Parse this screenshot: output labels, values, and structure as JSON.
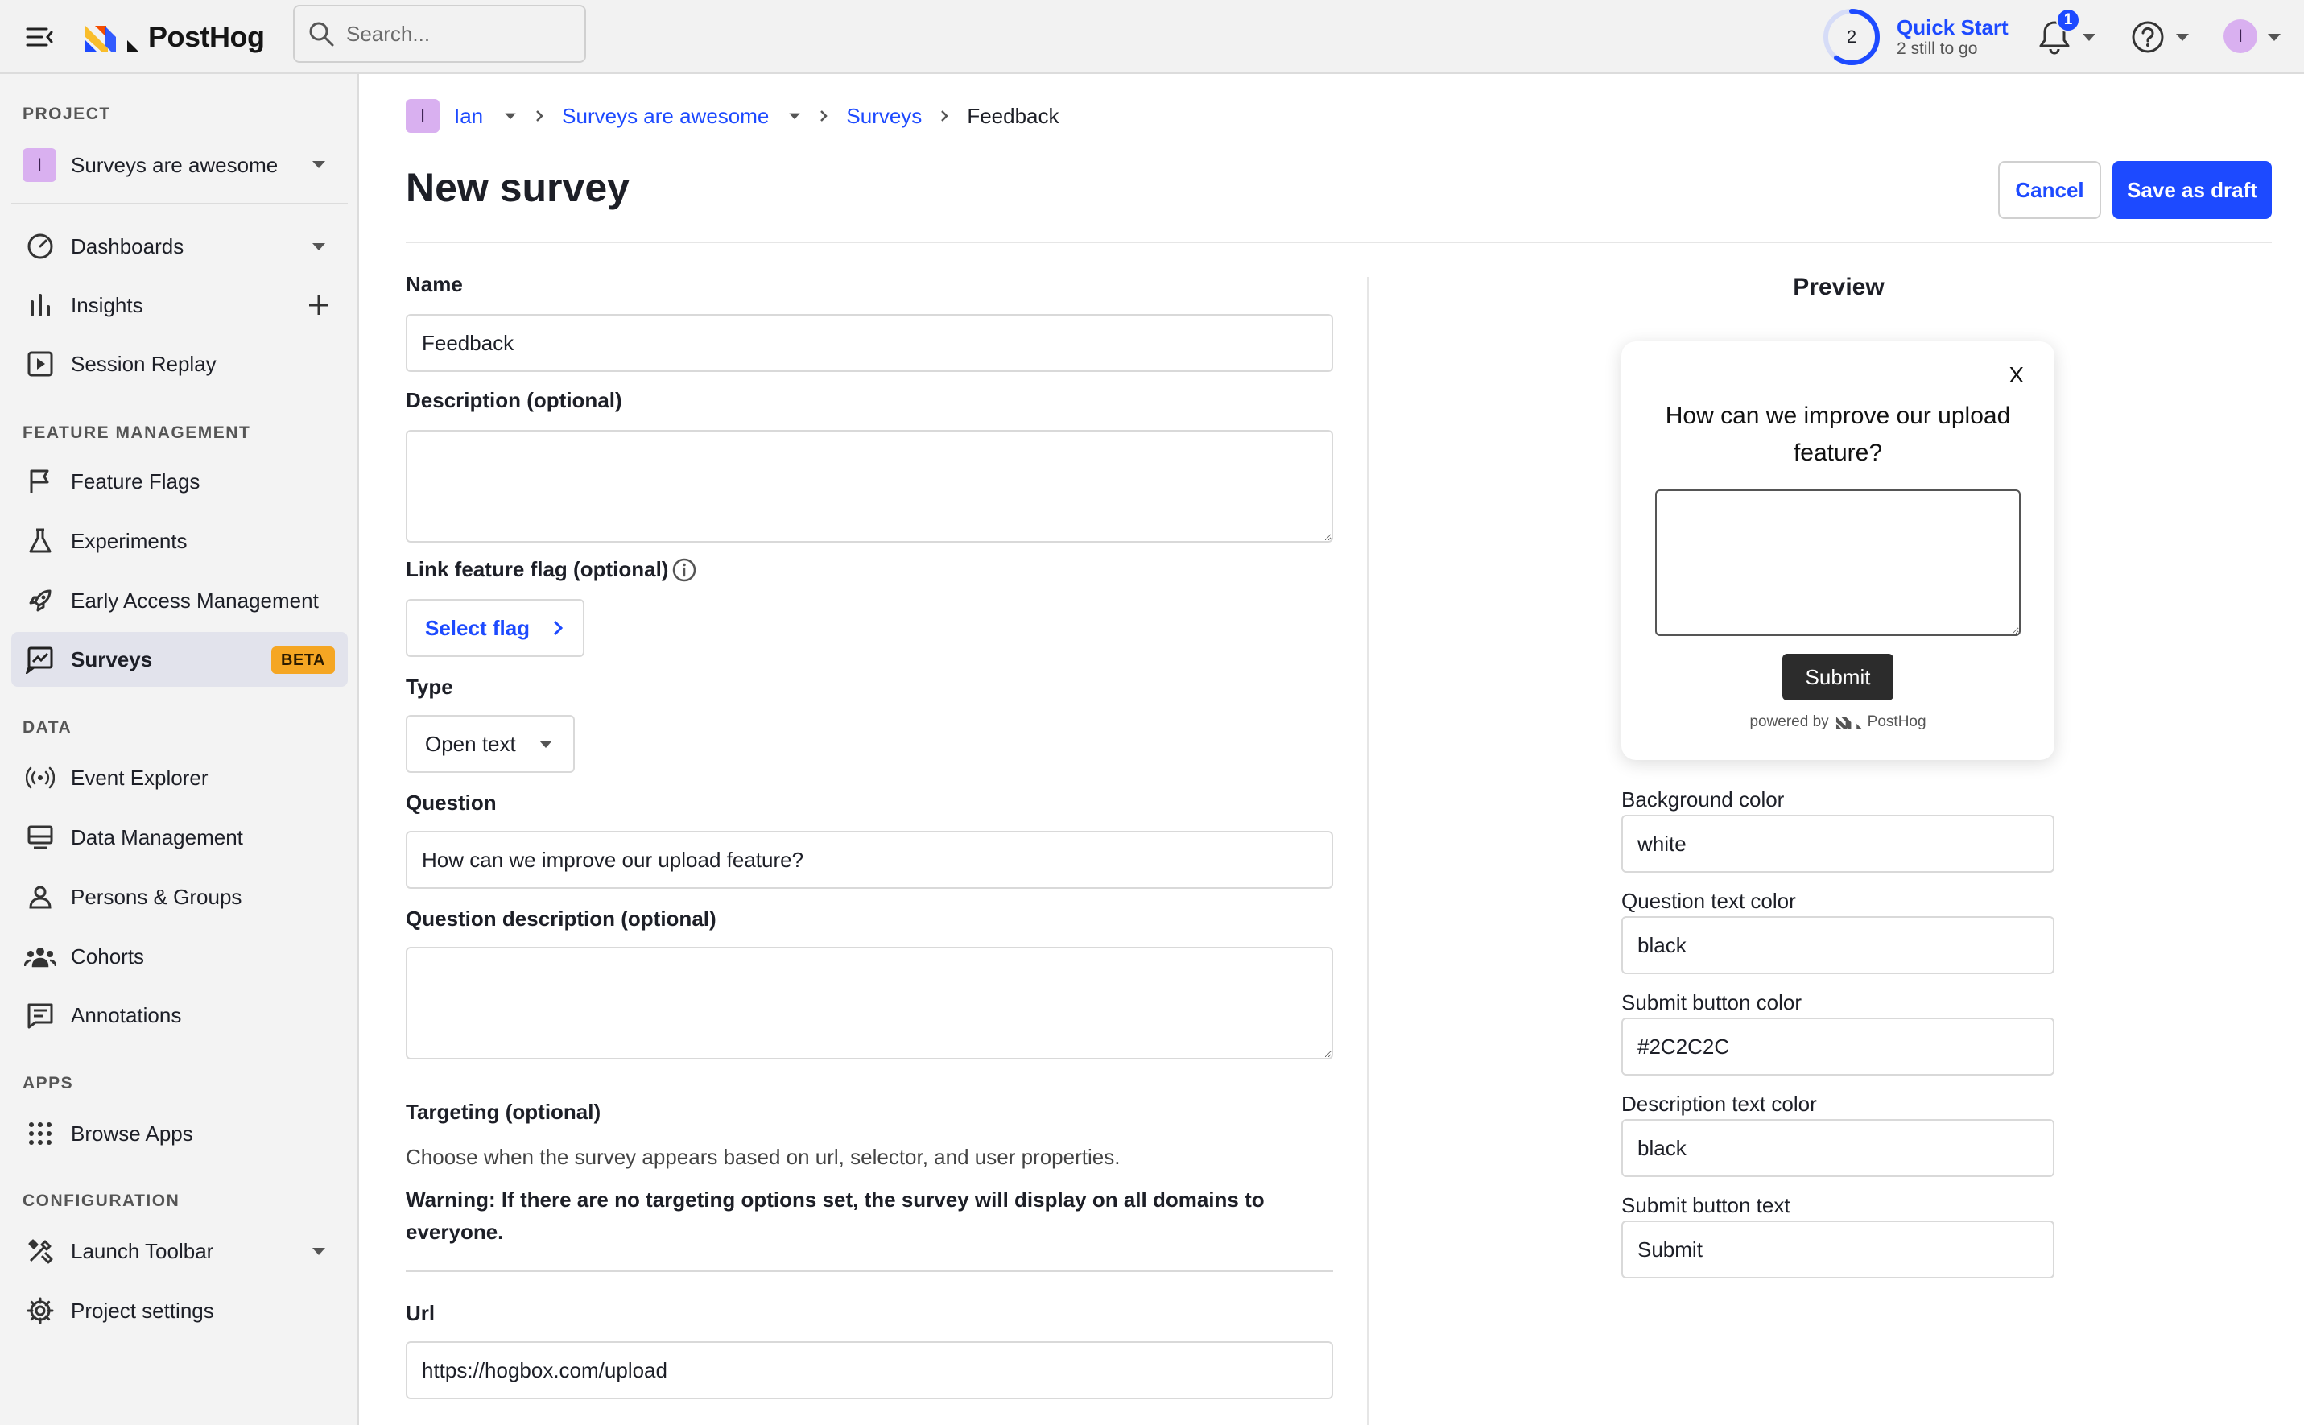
{
  "topbar": {
    "brand": "PostHog",
    "search_placeholder": "Search...",
    "quick_start": {
      "count": "2",
      "title": "Quick Start",
      "subtitle": "2 still to go",
      "progress": 0.6
    },
    "notifications_count": "1",
    "user_initial": "I"
  },
  "sidebar": {
    "project_section": "PROJECT",
    "project": {
      "initial": "I",
      "name": "Surveys are awesome"
    },
    "items_top": [
      {
        "label": "Dashboards"
      },
      {
        "label": "Insights"
      },
      {
        "label": "Session Replay"
      }
    ],
    "feature_section": "FEATURE MANAGEMENT",
    "feature_items": [
      {
        "label": "Feature Flags"
      },
      {
        "label": "Experiments"
      },
      {
        "label": "Early Access Management"
      },
      {
        "label": "Surveys",
        "badge": "BETA"
      }
    ],
    "data_section": "DATA",
    "data_items": [
      {
        "label": "Event Explorer"
      },
      {
        "label": "Data Management"
      },
      {
        "label": "Persons & Groups"
      },
      {
        "label": "Cohorts"
      },
      {
        "label": "Annotations"
      }
    ],
    "apps_section": "APPS",
    "apps_items": [
      {
        "label": "Browse Apps"
      }
    ],
    "config_section": "CONFIGURATION",
    "config_items": [
      {
        "label": "Launch Toolbar"
      },
      {
        "label": "Project settings"
      }
    ]
  },
  "breadcrumbs": {
    "org_initial": "I",
    "org": "Ian",
    "project": "Surveys are awesome",
    "section": "Surveys",
    "current": "Feedback"
  },
  "page": {
    "title": "New survey",
    "cancel": "Cancel",
    "save_draft": "Save as draft"
  },
  "form": {
    "name_label": "Name",
    "name_value": "Feedback",
    "description_label": "Description (optional)",
    "description_value": "",
    "flag_label": "Link feature flag (optional)",
    "flag_button": "Select flag",
    "type_label": "Type",
    "type_value": "Open text",
    "question_label": "Question",
    "question_value": "How can we improve our upload feature?",
    "question_desc_label": "Question description (optional)",
    "question_desc_value": "",
    "targeting_label": "Targeting (optional)",
    "targeting_help": "Choose when the survey appears based on url, selector, and user properties.",
    "targeting_warning": "Warning: If there are no targeting options set, the survey will display on all domains to everyone.",
    "url_label": "Url",
    "url_value": "https://hogbox.com/upload"
  },
  "preview": {
    "title": "Preview",
    "close": "X",
    "question": "How can we improve our upload feature?",
    "submit": "Submit",
    "powered_by": "powered by",
    "brand": "PostHog",
    "bg_color_label": "Background color",
    "bg_color_value": "white",
    "question_color_label": "Question text color",
    "question_color_value": "black",
    "submit_color_label": "Submit button color",
    "submit_color_value": "#2C2C2C",
    "desc_color_label": "Description text color",
    "desc_color_value": "black",
    "submit_text_label": "Submit button text",
    "submit_text_value": "Submit"
  },
  "colors": {
    "accent": "#1d4aff",
    "beta": "#f5a623",
    "submit_bg": "#2c2c2c",
    "badge": "#d9b0f0"
  }
}
